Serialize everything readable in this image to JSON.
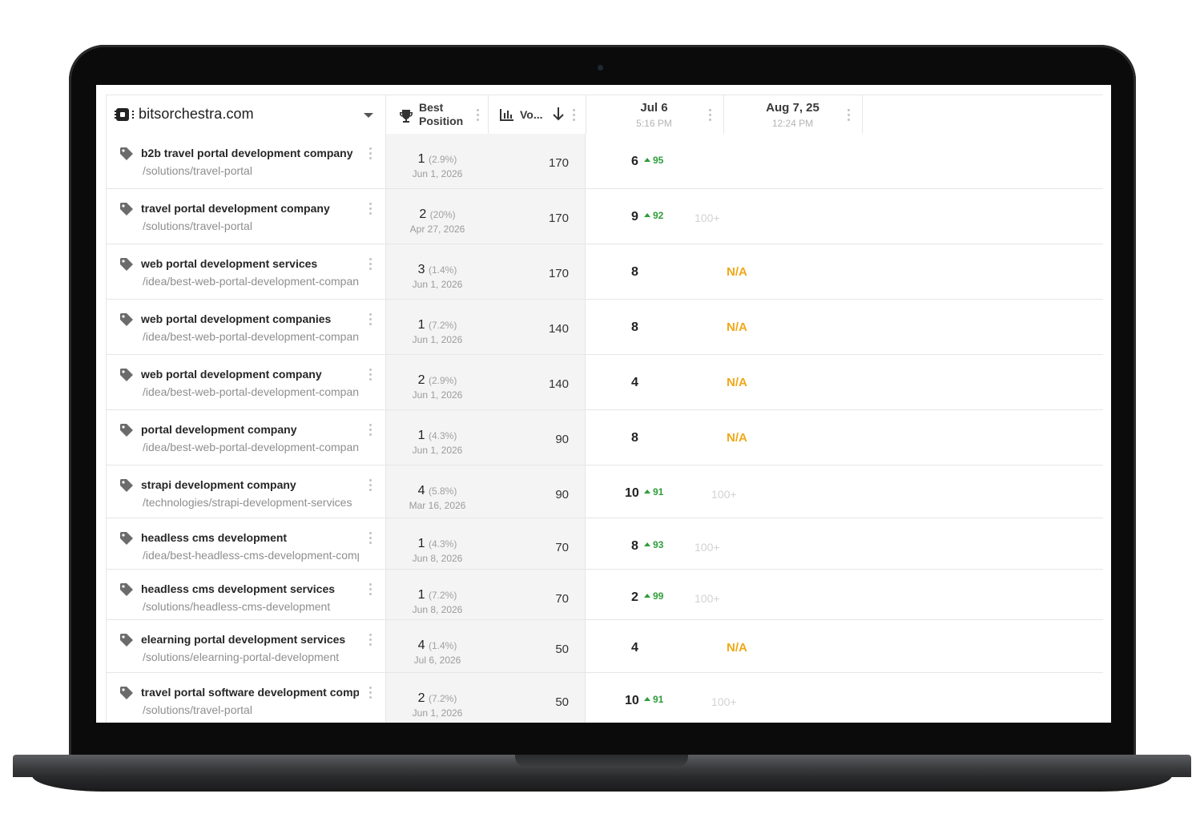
{
  "header": {
    "project": "bitsorchestra.com",
    "best_position_line1": "Best",
    "best_position_line2": "Position",
    "volume": "Vo...",
    "columns": [
      {
        "date": "Jul 6",
        "time": "5:16 PM"
      },
      {
        "date": "Aug 7, 25",
        "time": "12:24 PM"
      }
    ]
  },
  "rows": [
    {
      "keyword": "b2b travel portal development company",
      "url": "/solutions/travel-portal",
      "best": "1",
      "best_pct": "(2.9%)",
      "best_date": "Jun 1, 2026",
      "volume": "170",
      "pos": "6",
      "change": "95",
      "prev": ""
    },
    {
      "keyword": "travel portal development company",
      "url": "/solutions/travel-portal",
      "best": "2",
      "best_pct": "(20%)",
      "best_date": "Apr 27, 2026",
      "volume": "170",
      "pos": "9",
      "change": "92",
      "prev": "100+"
    },
    {
      "keyword": "web portal development services",
      "url": "/idea/best-web-portal-development-companies",
      "best": "3",
      "best_pct": "(1.4%)",
      "best_date": "Jun 1, 2026",
      "volume": "170",
      "pos": "8",
      "change": "",
      "prev": "N/A"
    },
    {
      "keyword": "web portal development companies",
      "url": "/idea/best-web-portal-development-companies",
      "best": "1",
      "best_pct": "(7.2%)",
      "best_date": "Jun 1, 2026",
      "volume": "140",
      "pos": "8",
      "change": "",
      "prev": "N/A"
    },
    {
      "keyword": "web portal development company",
      "url": "/idea/best-web-portal-development-companies",
      "best": "2",
      "best_pct": "(2.9%)",
      "best_date": "Jun 1, 2026",
      "volume": "140",
      "pos": "4",
      "change": "",
      "prev": "N/A"
    },
    {
      "keyword": "portal development company",
      "url": "/idea/best-web-portal-development-companies",
      "best": "1",
      "best_pct": "(4.3%)",
      "best_date": "Jun 1, 2026",
      "volume": "90",
      "pos": "8",
      "change": "",
      "prev": "N/A"
    },
    {
      "keyword": "strapi development company",
      "url": "/technologies/strapi-development-services",
      "best": "4",
      "best_pct": "(5.8%)",
      "best_date": "Mar 16, 2026",
      "volume": "90",
      "pos": "10",
      "change": "91",
      "prev": "100+"
    },
    {
      "keyword": "headless cms development",
      "url": "/idea/best-headless-cms-development-companies",
      "best": "1",
      "best_pct": "(4.3%)",
      "best_date": "Jun 8, 2026",
      "volume": "70",
      "pos": "8",
      "change": "93",
      "prev": "100+"
    },
    {
      "keyword": "headless cms development services",
      "url": "/solutions/headless-cms-development",
      "best": "1",
      "best_pct": "(7.2%)",
      "best_date": "Jun 8, 2026",
      "volume": "70",
      "pos": "2",
      "change": "99",
      "prev": "100+"
    },
    {
      "keyword": "elearning portal development services",
      "url": "/solutions/elearning-portal-development",
      "best": "4",
      "best_pct": "(1.4%)",
      "best_date": "Jul 6, 2026",
      "volume": "50",
      "pos": "4",
      "change": "",
      "prev": "N/A"
    },
    {
      "keyword": "travel portal software development company",
      "url": "/solutions/travel-portal",
      "best": "2",
      "best_pct": "(7.2%)",
      "best_date": "Jun 1, 2026",
      "volume": "50",
      "pos": "10",
      "change": "91",
      "prev": "100+"
    }
  ],
  "colors": {
    "up": "#2e9d3a",
    "na": "#f0a818",
    "muted": "#d2d2d2"
  }
}
